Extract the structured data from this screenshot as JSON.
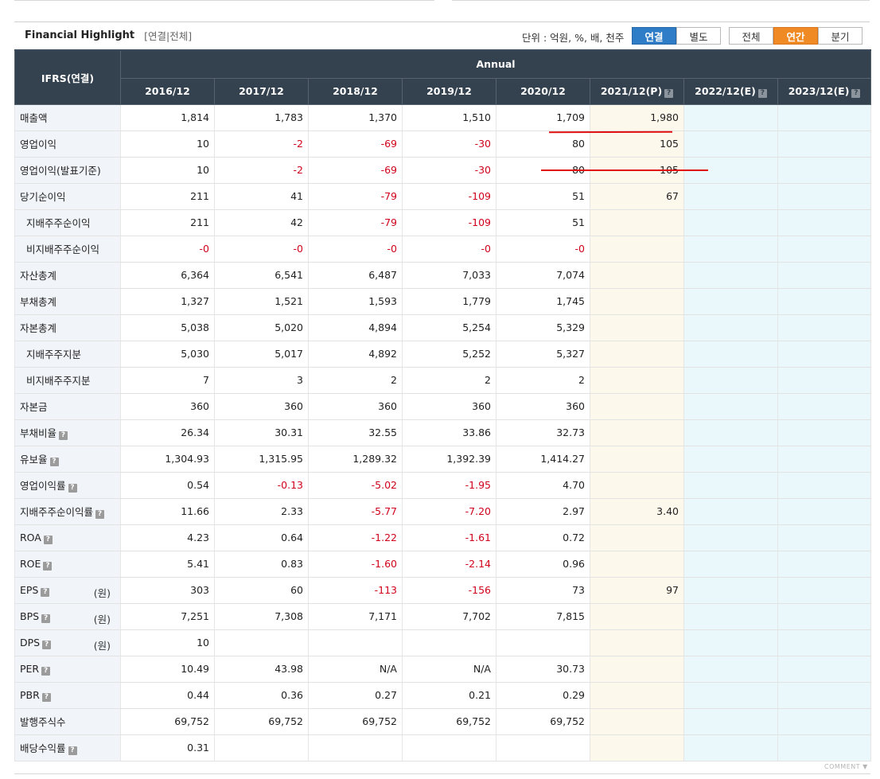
{
  "header": {
    "title": "Financial Highlight",
    "subtitle": "[연결|전체]",
    "unit_label": "단위 : 억원, %, 배, 천주",
    "scope_buttons": [
      "연결",
      "별도"
    ],
    "period_buttons": [
      "전체",
      "연간",
      "분기"
    ]
  },
  "table": {
    "corner_label": "IFRS(연결)",
    "group_label": "Annual",
    "help_glyph": "?",
    "columns": [
      "2016/12",
      "2017/12",
      "2018/12",
      "2019/12",
      "2020/12",
      "2021/12(P)",
      "2022/12(E)",
      "2023/12(E)"
    ],
    "rows": [
      {
        "label": "매출액",
        "values": [
          "1,814",
          "1,783",
          "1,370",
          "1,510",
          "1,709",
          "1,980",
          "",
          ""
        ]
      },
      {
        "label": "영업이익",
        "values": [
          "10",
          "-2",
          "-69",
          "-30",
          "80",
          "105",
          "",
          ""
        ]
      },
      {
        "label": "영업이익(발표기준)",
        "values": [
          "10",
          "-2",
          "-69",
          "-30",
          "80",
          "105",
          "",
          ""
        ]
      },
      {
        "label": "당기순이익",
        "values": [
          "211",
          "41",
          "-79",
          "-109",
          "51",
          "67",
          "",
          ""
        ]
      },
      {
        "label": "지배주주순이익",
        "values": [
          "211",
          "42",
          "-79",
          "-109",
          "51",
          "",
          "",
          ""
        ]
      },
      {
        "label": "비지배주주순이익",
        "values": [
          "-0",
          "-0",
          "-0",
          "-0",
          "-0",
          "",
          "",
          ""
        ]
      },
      {
        "label": "자산총계",
        "values": [
          "6,364",
          "6,541",
          "6,487",
          "7,033",
          "7,074",
          "",
          "",
          ""
        ]
      },
      {
        "label": "부채총계",
        "values": [
          "1,327",
          "1,521",
          "1,593",
          "1,779",
          "1,745",
          "",
          "",
          ""
        ]
      },
      {
        "label": "자본총계",
        "values": [
          "5,038",
          "5,020",
          "4,894",
          "5,254",
          "5,329",
          "",
          "",
          ""
        ]
      },
      {
        "label": "지배주주지분",
        "values": [
          "5,030",
          "5,017",
          "4,892",
          "5,252",
          "5,327",
          "",
          "",
          ""
        ]
      },
      {
        "label": "비지배주주지분",
        "values": [
          "7",
          "3",
          "2",
          "2",
          "2",
          "",
          "",
          ""
        ]
      },
      {
        "label": "자본금",
        "values": [
          "360",
          "360",
          "360",
          "360",
          "360",
          "",
          "",
          ""
        ]
      },
      {
        "label": "부채비율",
        "values": [
          "26.34",
          "30.31",
          "32.55",
          "33.86",
          "32.73",
          "",
          "",
          ""
        ]
      },
      {
        "label": "유보율",
        "values": [
          "1,304.93",
          "1,315.95",
          "1,289.32",
          "1,392.39",
          "1,414.27",
          "",
          "",
          ""
        ]
      },
      {
        "label": "영업이익률",
        "values": [
          "0.54",
          "-0.13",
          "-5.02",
          "-1.95",
          "4.70",
          "",
          "",
          ""
        ]
      },
      {
        "label": "지배주주순이익률",
        "values": [
          "11.66",
          "2.33",
          "-5.77",
          "-7.20",
          "2.97",
          "3.40",
          "",
          ""
        ]
      },
      {
        "label": "ROA",
        "values": [
          "4.23",
          "0.64",
          "-1.22",
          "-1.61",
          "0.72",
          "",
          "",
          ""
        ]
      },
      {
        "label": "ROE",
        "values": [
          "5.41",
          "0.83",
          "-1.60",
          "-2.14",
          "0.96",
          "",
          "",
          ""
        ]
      },
      {
        "label": "EPS",
        "unit": "(원)",
        "values": [
          "303",
          "60",
          "-113",
          "-156",
          "73",
          "97",
          "",
          ""
        ]
      },
      {
        "label": "BPS",
        "unit": "(원)",
        "values": [
          "7,251",
          "7,308",
          "7,171",
          "7,702",
          "7,815",
          "",
          "",
          ""
        ]
      },
      {
        "label": "DPS",
        "unit": "(원)",
        "values": [
          "10",
          "",
          "",
          "",
          "",
          "",
          "",
          ""
        ]
      },
      {
        "label": "PER",
        "values": [
          "10.49",
          "43.98",
          "N/A",
          "N/A",
          "30.73",
          "",
          "",
          ""
        ]
      },
      {
        "label": "PBR",
        "values": [
          "0.44",
          "0.36",
          "0.27",
          "0.21",
          "0.29",
          "",
          "",
          ""
        ]
      },
      {
        "label": "발행주식수",
        "values": [
          "69,752",
          "69,752",
          "69,752",
          "69,752",
          "69,752",
          "",
          "",
          ""
        ]
      },
      {
        "label": "배당수익률",
        "values": [
          "0.31",
          "",
          "",
          "",
          "",
          "",
          "",
          ""
        ]
      }
    ]
  },
  "footer": {
    "comment_label": "COMMENT ▼"
  },
  "colors": {
    "header_bg": "#34414e",
    "accent_blue": "#2e7dc6",
    "accent_orange": "#f08a24",
    "negative": "#d0021b",
    "provisional_bg": "#fdf8ec",
    "estimate_bg": "#eaf7fb",
    "annotation_red": "#e01010"
  }
}
